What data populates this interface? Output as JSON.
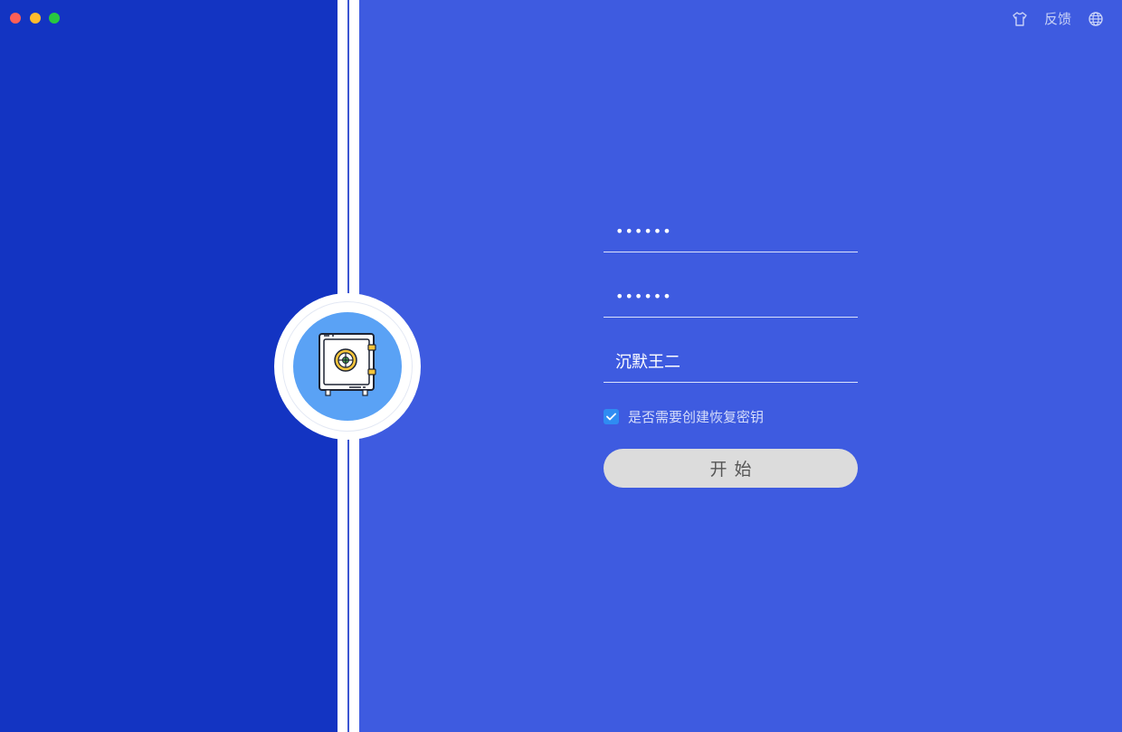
{
  "window": {
    "controls": [
      "close",
      "minimize",
      "maximize"
    ]
  },
  "toolbar": {
    "theme_icon": "tshirt-icon",
    "feedback_label": "反馈",
    "language_icon": "globe-icon"
  },
  "badge": {
    "icon": "safe-icon"
  },
  "form": {
    "password": {
      "masked_value": "••••••"
    },
    "confirm_password": {
      "masked_value": "••••••"
    },
    "username": {
      "value": "沉默王二"
    },
    "recovery_key": {
      "label": "是否需要创建恢复密钥",
      "checked": true
    },
    "start_button": {
      "label": "开始"
    }
  },
  "colors": {
    "left_panel": "#1334c2",
    "right_panel": "#3e5be0",
    "checkbox": "#2f8cf2",
    "button_bg": "#dcdcdc"
  }
}
